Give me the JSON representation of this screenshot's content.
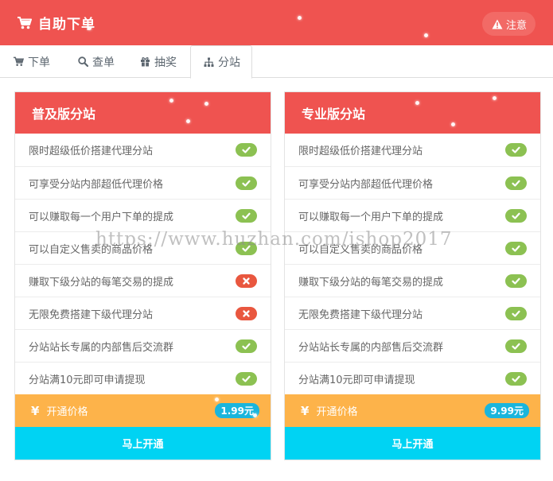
{
  "header": {
    "title": "自助下单",
    "notice_label": "注意",
    "cart_icon": "shopping-cart-icon",
    "notice_icon": "warning-icon"
  },
  "tabs": [
    {
      "label": "下单",
      "icon": "cart-icon",
      "active": false
    },
    {
      "label": "查单",
      "icon": "search-icon",
      "active": false
    },
    {
      "label": "抽奖",
      "icon": "gift-icon",
      "active": false
    },
    {
      "label": "分站",
      "icon": "sitemap-icon",
      "active": true
    }
  ],
  "plans": [
    {
      "title": "普及版分站",
      "features": [
        {
          "text": "限时超级低价搭建代理分站",
          "included": true
        },
        {
          "text": "可享受分站内部超低代理价格",
          "included": true
        },
        {
          "text": "可以赚取每一个用户下单的提成",
          "included": true
        },
        {
          "text": "可以自定义售卖的商品价格",
          "included": true
        },
        {
          "text": "赚取下级分站的每笔交易的提成",
          "included": false
        },
        {
          "text": "无限免费搭建下级代理分站",
          "included": false
        },
        {
          "text": "分站站长专属的内部售后交流群",
          "included": true
        },
        {
          "text": "分站满10元即可申请提现",
          "included": true
        }
      ],
      "price_label": "开通价格",
      "price_symbol": "¥",
      "price": "1.99元",
      "button_label": "马上开通"
    },
    {
      "title": "专业版分站",
      "features": [
        {
          "text": "限时超级低价搭建代理分站",
          "included": true
        },
        {
          "text": "可享受分站内部超低代理价格",
          "included": true
        },
        {
          "text": "可以赚取每一个用户下单的提成",
          "included": true
        },
        {
          "text": "可以自定义售卖的商品价格",
          "included": true
        },
        {
          "text": "赚取下级分站的每笔交易的提成",
          "included": true
        },
        {
          "text": "无限免费搭建下级代理分站",
          "included": true
        },
        {
          "text": "分站站长专属的内部售后交流群",
          "included": true
        },
        {
          "text": "分站满10元即可申请提现",
          "included": true
        }
      ],
      "price_label": "开通价格",
      "price_symbol": "¥",
      "price": "9.99元",
      "button_label": "马上开通"
    }
  ],
  "watermark": "https://www.huzhan.com/ishop2017",
  "colors": {
    "header": "#ef5350",
    "check": "#8cc152",
    "cross": "#e9573f",
    "price_bar": "#fdb34a",
    "price_badge": "#1ab5dc",
    "button": "#00d3f3"
  }
}
